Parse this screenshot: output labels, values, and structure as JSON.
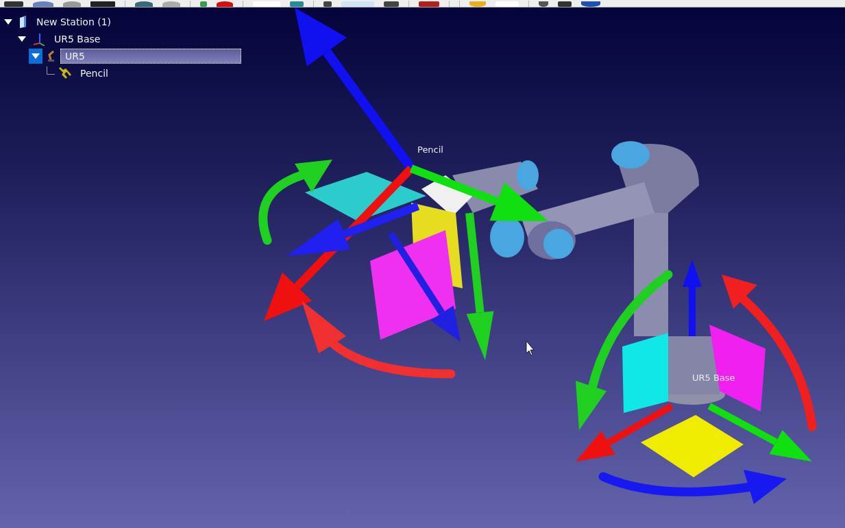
{
  "tree": [
    {
      "label": "New Station (1)",
      "kind": "station",
      "expanded": true,
      "selected": false,
      "children": [
        {
          "label": "UR5 Base",
          "kind": "frame",
          "expanded": true,
          "selected": false,
          "children": [
            {
              "label": "UR5",
              "kind": "robot",
              "expanded": true,
              "selected": true,
              "children": [
                {
                  "label": "Pencil",
                  "kind": "tool",
                  "selected": false
                }
              ]
            }
          ]
        }
      ]
    }
  ],
  "scene": {
    "labels": [
      {
        "text": "Pencil",
        "kind": "tool"
      },
      {
        "text": "UR5 Base",
        "kind": "frame"
      }
    ]
  }
}
